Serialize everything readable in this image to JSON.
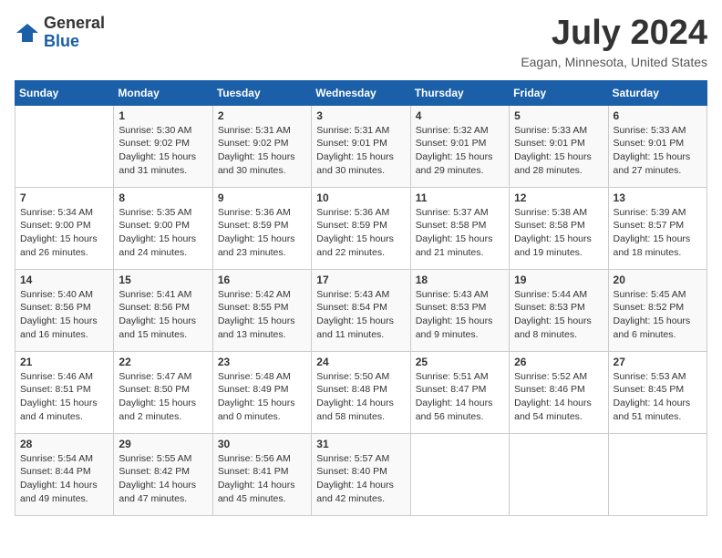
{
  "header": {
    "logo_general": "General",
    "logo_blue": "Blue",
    "month_title": "July 2024",
    "location": "Eagan, Minnesota, United States"
  },
  "days_of_week": [
    "Sunday",
    "Monday",
    "Tuesday",
    "Wednesday",
    "Thursday",
    "Friday",
    "Saturday"
  ],
  "weeks": [
    [
      {
        "day": "",
        "info": ""
      },
      {
        "day": "1",
        "info": "Sunrise: 5:30 AM\nSunset: 9:02 PM\nDaylight: 15 hours\nand 31 minutes."
      },
      {
        "day": "2",
        "info": "Sunrise: 5:31 AM\nSunset: 9:02 PM\nDaylight: 15 hours\nand 30 minutes."
      },
      {
        "day": "3",
        "info": "Sunrise: 5:31 AM\nSunset: 9:01 PM\nDaylight: 15 hours\nand 30 minutes."
      },
      {
        "day": "4",
        "info": "Sunrise: 5:32 AM\nSunset: 9:01 PM\nDaylight: 15 hours\nand 29 minutes."
      },
      {
        "day": "5",
        "info": "Sunrise: 5:33 AM\nSunset: 9:01 PM\nDaylight: 15 hours\nand 28 minutes."
      },
      {
        "day": "6",
        "info": "Sunrise: 5:33 AM\nSunset: 9:01 PM\nDaylight: 15 hours\nand 27 minutes."
      }
    ],
    [
      {
        "day": "7",
        "info": "Sunrise: 5:34 AM\nSunset: 9:00 PM\nDaylight: 15 hours\nand 26 minutes."
      },
      {
        "day": "8",
        "info": "Sunrise: 5:35 AM\nSunset: 9:00 PM\nDaylight: 15 hours\nand 24 minutes."
      },
      {
        "day": "9",
        "info": "Sunrise: 5:36 AM\nSunset: 8:59 PM\nDaylight: 15 hours\nand 23 minutes."
      },
      {
        "day": "10",
        "info": "Sunrise: 5:36 AM\nSunset: 8:59 PM\nDaylight: 15 hours\nand 22 minutes."
      },
      {
        "day": "11",
        "info": "Sunrise: 5:37 AM\nSunset: 8:58 PM\nDaylight: 15 hours\nand 21 minutes."
      },
      {
        "day": "12",
        "info": "Sunrise: 5:38 AM\nSunset: 8:58 PM\nDaylight: 15 hours\nand 19 minutes."
      },
      {
        "day": "13",
        "info": "Sunrise: 5:39 AM\nSunset: 8:57 PM\nDaylight: 15 hours\nand 18 minutes."
      }
    ],
    [
      {
        "day": "14",
        "info": "Sunrise: 5:40 AM\nSunset: 8:56 PM\nDaylight: 15 hours\nand 16 minutes."
      },
      {
        "day": "15",
        "info": "Sunrise: 5:41 AM\nSunset: 8:56 PM\nDaylight: 15 hours\nand 15 minutes."
      },
      {
        "day": "16",
        "info": "Sunrise: 5:42 AM\nSunset: 8:55 PM\nDaylight: 15 hours\nand 13 minutes."
      },
      {
        "day": "17",
        "info": "Sunrise: 5:43 AM\nSunset: 8:54 PM\nDaylight: 15 hours\nand 11 minutes."
      },
      {
        "day": "18",
        "info": "Sunrise: 5:43 AM\nSunset: 8:53 PM\nDaylight: 15 hours\nand 9 minutes."
      },
      {
        "day": "19",
        "info": "Sunrise: 5:44 AM\nSunset: 8:53 PM\nDaylight: 15 hours\nand 8 minutes."
      },
      {
        "day": "20",
        "info": "Sunrise: 5:45 AM\nSunset: 8:52 PM\nDaylight: 15 hours\nand 6 minutes."
      }
    ],
    [
      {
        "day": "21",
        "info": "Sunrise: 5:46 AM\nSunset: 8:51 PM\nDaylight: 15 hours\nand 4 minutes."
      },
      {
        "day": "22",
        "info": "Sunrise: 5:47 AM\nSunset: 8:50 PM\nDaylight: 15 hours\nand 2 minutes."
      },
      {
        "day": "23",
        "info": "Sunrise: 5:48 AM\nSunset: 8:49 PM\nDaylight: 15 hours\nand 0 minutes."
      },
      {
        "day": "24",
        "info": "Sunrise: 5:50 AM\nSunset: 8:48 PM\nDaylight: 14 hours\nand 58 minutes."
      },
      {
        "day": "25",
        "info": "Sunrise: 5:51 AM\nSunset: 8:47 PM\nDaylight: 14 hours\nand 56 minutes."
      },
      {
        "day": "26",
        "info": "Sunrise: 5:52 AM\nSunset: 8:46 PM\nDaylight: 14 hours\nand 54 minutes."
      },
      {
        "day": "27",
        "info": "Sunrise: 5:53 AM\nSunset: 8:45 PM\nDaylight: 14 hours\nand 51 minutes."
      }
    ],
    [
      {
        "day": "28",
        "info": "Sunrise: 5:54 AM\nSunset: 8:44 PM\nDaylight: 14 hours\nand 49 minutes."
      },
      {
        "day": "29",
        "info": "Sunrise: 5:55 AM\nSunset: 8:42 PM\nDaylight: 14 hours\nand 47 minutes."
      },
      {
        "day": "30",
        "info": "Sunrise: 5:56 AM\nSunset: 8:41 PM\nDaylight: 14 hours\nand 45 minutes."
      },
      {
        "day": "31",
        "info": "Sunrise: 5:57 AM\nSunset: 8:40 PM\nDaylight: 14 hours\nand 42 minutes."
      },
      {
        "day": "",
        "info": ""
      },
      {
        "day": "",
        "info": ""
      },
      {
        "day": "",
        "info": ""
      }
    ]
  ]
}
